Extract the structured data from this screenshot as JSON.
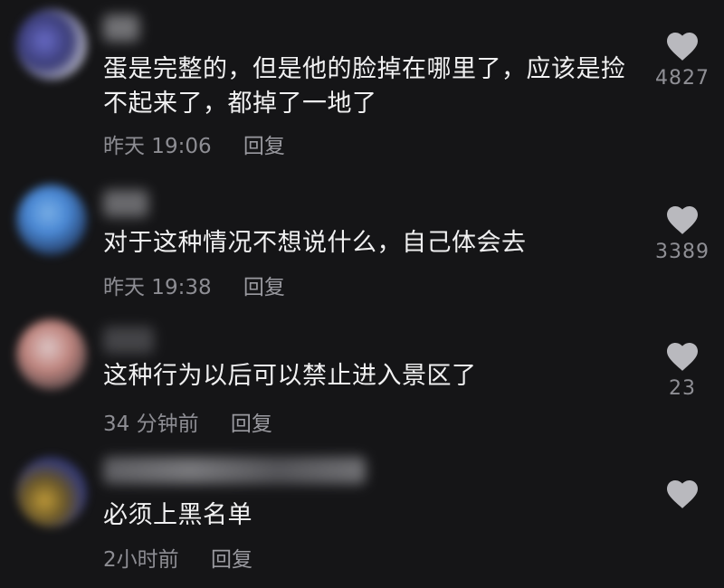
{
  "comments": [
    {
      "text": "蛋是完整的，但是他的脸掉在哪里了，应该是捡不起来了，都掉了一地了",
      "time": "昨天 19:06",
      "reply": "回复",
      "likes": "4827",
      "avatar_colors": [
        "#6c6fd0",
        "#3b3d7a",
        "#c9c9d6"
      ]
    },
    {
      "text": "对于这种情况不想说什么，自己体会去",
      "time": "昨天 19:38",
      "reply": "回复",
      "likes": "3389",
      "avatar_colors": [
        "#4d8fe0",
        "#7fb7f0",
        "#2b4a7a"
      ]
    },
    {
      "text": "这种行为以后可以禁止进入景区了",
      "time": "34 分钟前",
      "reply": "回复",
      "likes": "23",
      "avatar_colors": [
        "#c98b84",
        "#e8d0d0",
        "#6e5656"
      ]
    },
    {
      "text": "必须上黑名单",
      "time": "2小时前",
      "reply": "回复",
      "likes": "",
      "avatar_colors": [
        "#c9a23a",
        "#3a3f7a",
        "#6d5a2a"
      ]
    }
  ],
  "icons": {
    "like": "heart-icon"
  },
  "colors": {
    "background": "#151517",
    "text": "#f1f1f2",
    "meta": "#8d8d93",
    "heart": "#b9b9be"
  }
}
